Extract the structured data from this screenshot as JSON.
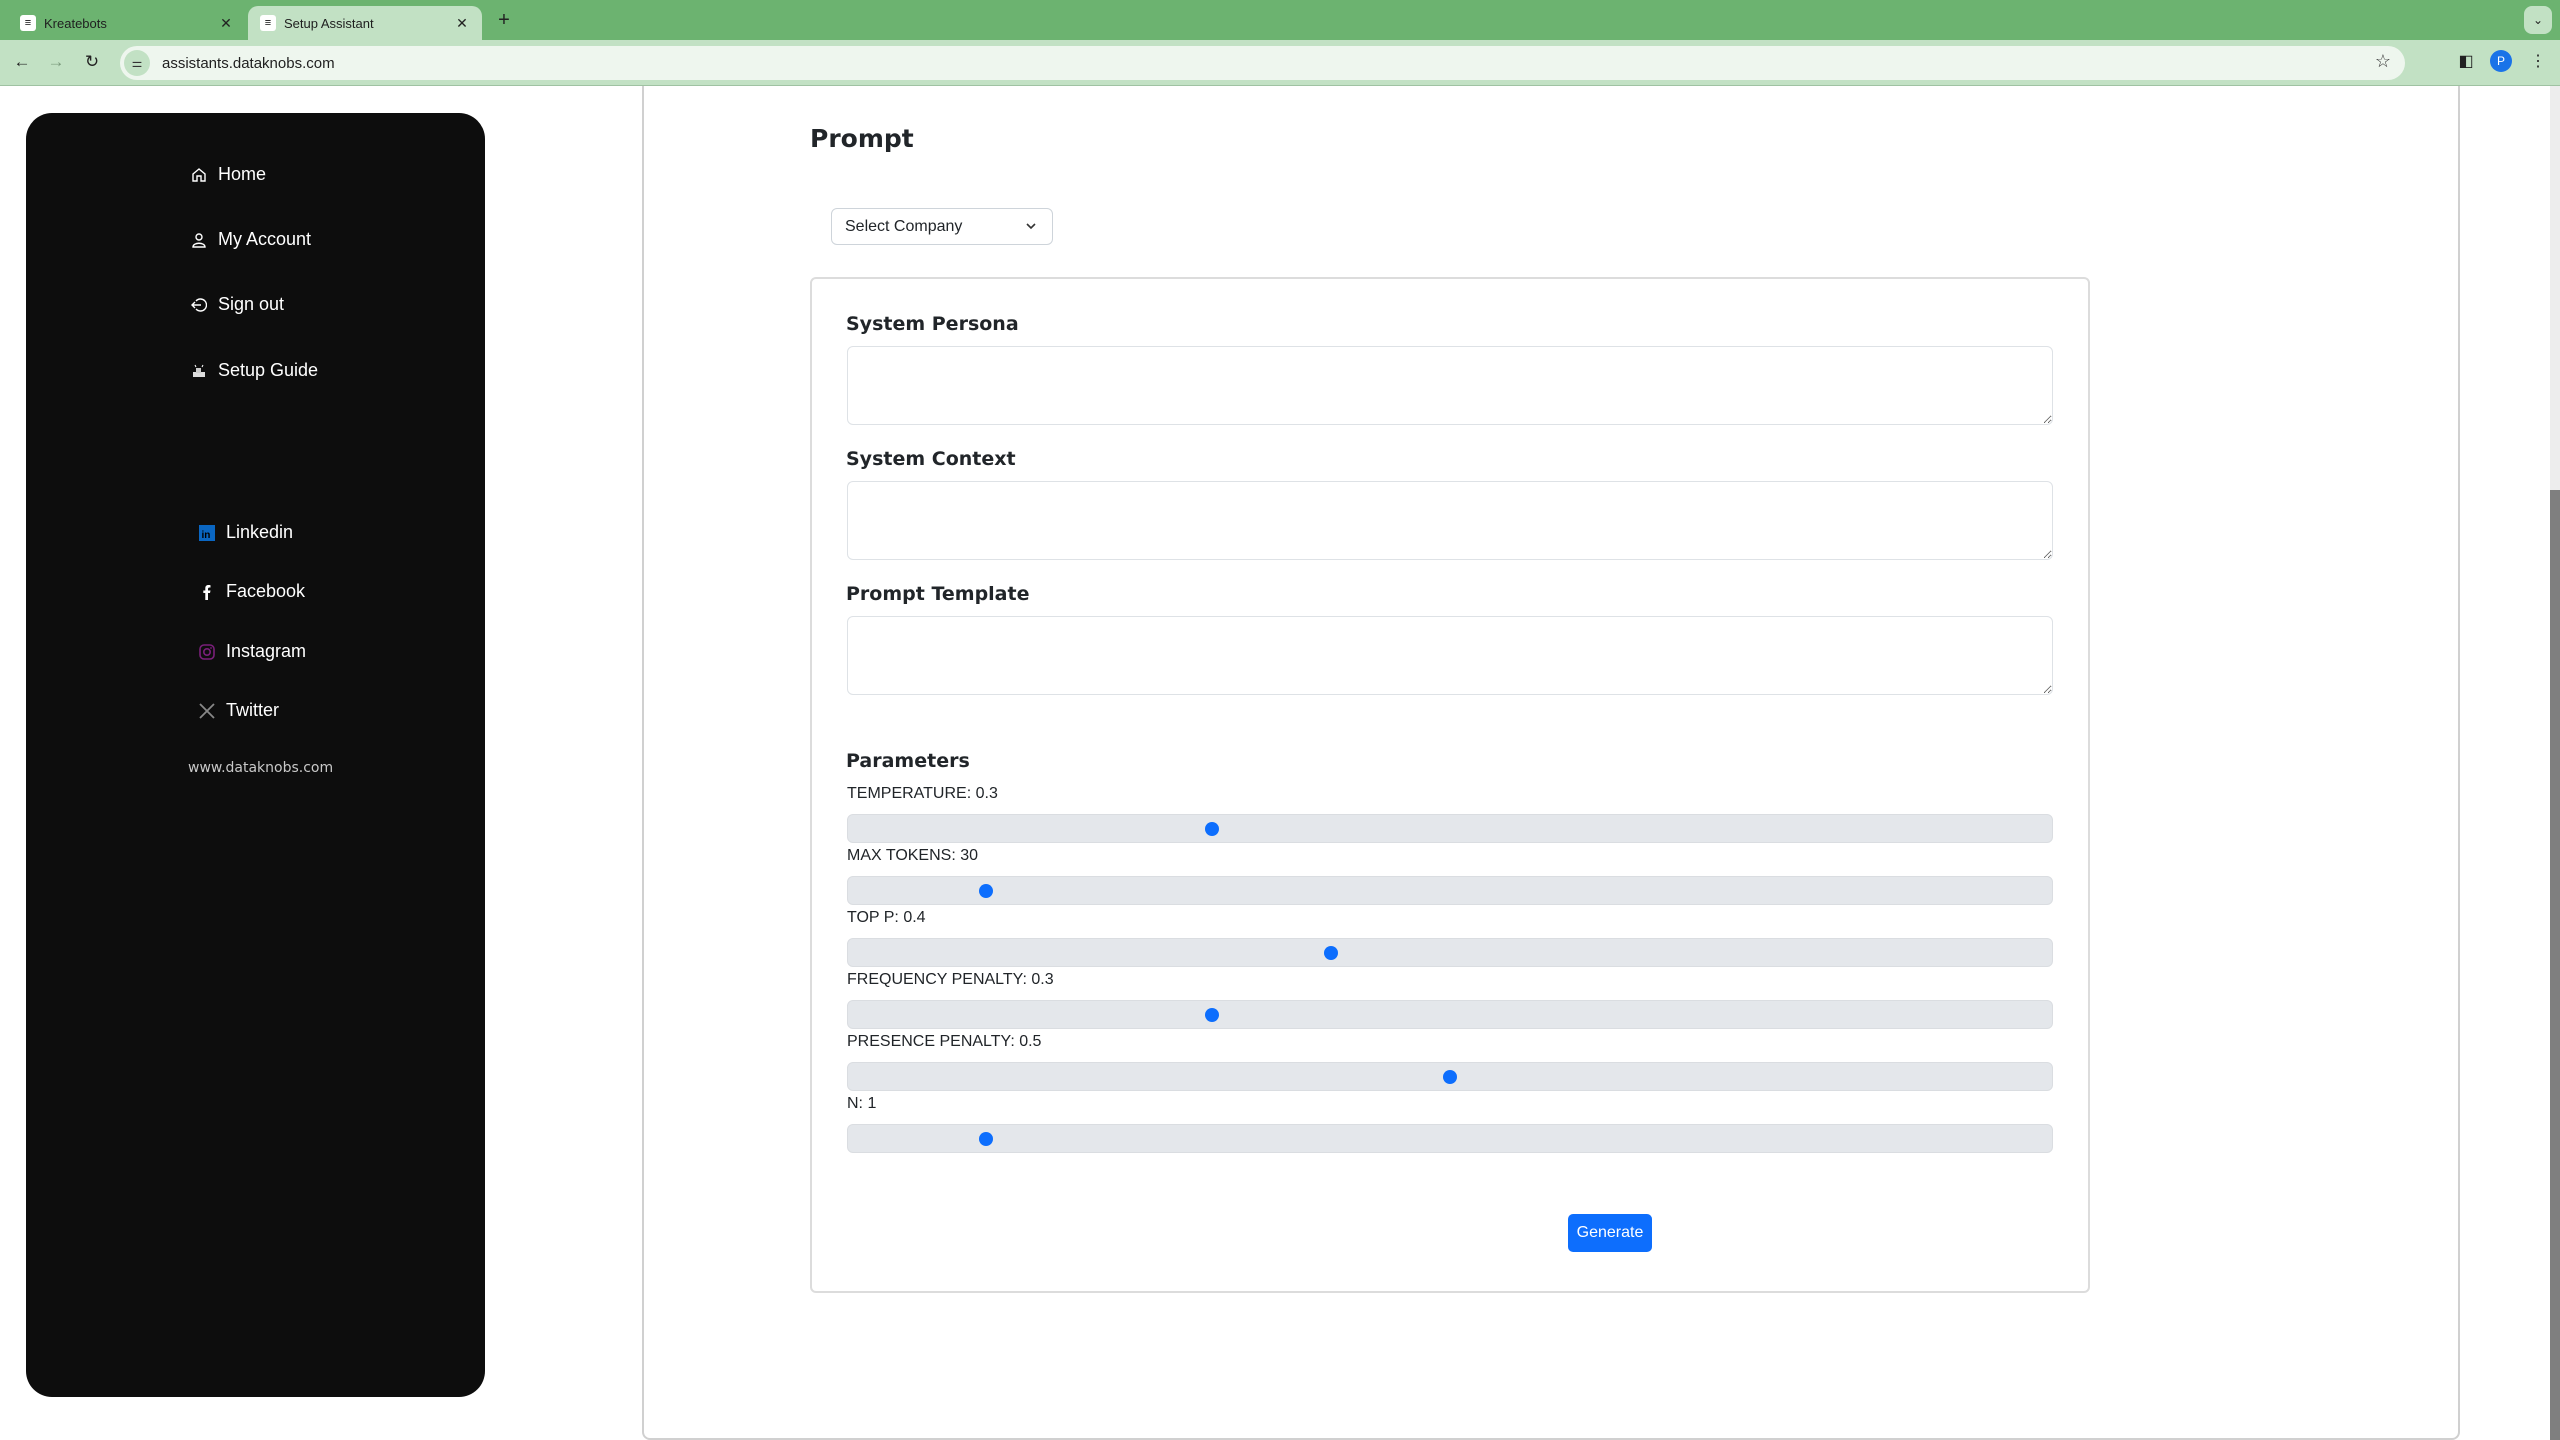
{
  "browser": {
    "tabs": [
      {
        "label": "Kreatebots",
        "active": false
      },
      {
        "label": "Setup Assistant",
        "active": true
      }
    ],
    "url": "assistants.dataknobs.com",
    "profile_initial": "P"
  },
  "sidebar": {
    "nav": [
      {
        "label": "Home",
        "icon": "home-icon"
      },
      {
        "label": "My Account",
        "icon": "user-icon"
      },
      {
        "label": "Sign out",
        "icon": "sign-out-icon"
      },
      {
        "label": "Setup Guide",
        "icon": "setup-guide-icon"
      }
    ],
    "social": [
      {
        "label": "Linkedin",
        "icon": "linkedin-icon",
        "color": "#0a66c2"
      },
      {
        "label": "Facebook",
        "icon": "facebook-icon",
        "color": "#ffffff"
      },
      {
        "label": "Instagram",
        "icon": "instagram-icon",
        "color": "#7a1f7a"
      },
      {
        "label": "Twitter",
        "icon": "x-twitter-icon",
        "color": "#888888"
      }
    ],
    "site_link": "www.dataknobs.com"
  },
  "main": {
    "title": "Prompt",
    "company_select": {
      "value": "Select Company"
    },
    "fields": [
      {
        "label": "System Persona",
        "value": ""
      },
      {
        "label": "System Context",
        "value": ""
      },
      {
        "label": "Prompt Template",
        "value": ""
      }
    ],
    "parameters_heading": "Parameters",
    "parameters": [
      {
        "label": "TEMPERATURE: 0.3",
        "name": "temperature",
        "value": 0.3,
        "position": 0.3
      },
      {
        "label": "MAX TOKENS: 30",
        "name": "max_tokens",
        "value": 30,
        "position": 0.11
      },
      {
        "label": "TOP P: 0.4",
        "name": "top_p",
        "value": 0.4,
        "position": 0.4
      },
      {
        "label": "FREQUENCY PENALTY: 0.3",
        "name": "frequency_penalty",
        "value": 0.3,
        "position": 0.3
      },
      {
        "label": "PRESENCE PENALTY: 0.5",
        "name": "presence_penalty",
        "value": 0.5,
        "position": 0.5
      },
      {
        "label": "N: 1",
        "name": "n",
        "value": 1,
        "position": 0.11
      }
    ],
    "generate_label": "Generate"
  },
  "colors": {
    "accent": "#0d6efd",
    "sidebar_bg": "#0d0d0d",
    "browser_frame": "#6cb370"
  }
}
